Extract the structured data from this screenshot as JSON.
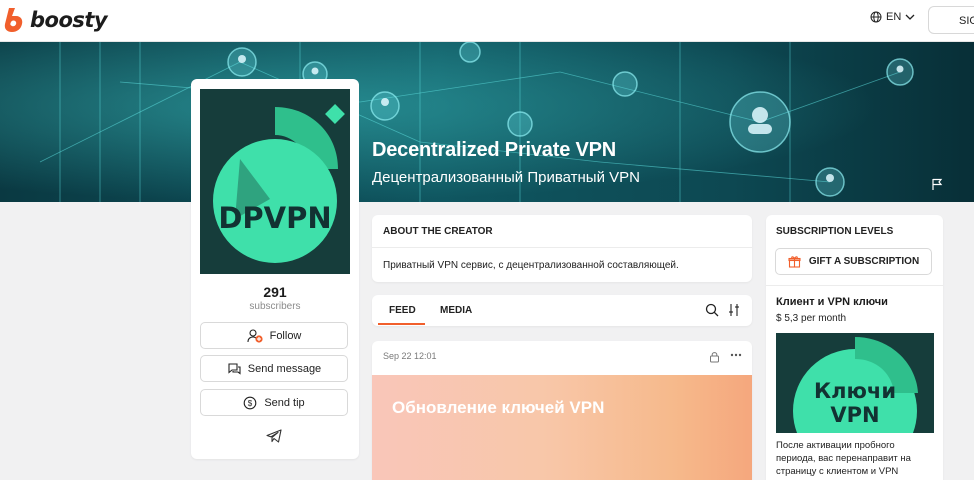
{
  "header": {
    "brand": "boosty",
    "language": "EN",
    "signin_label": "SIG"
  },
  "banner": {
    "title": "Decentralized Private VPN",
    "subtitle": "Децентрализованный Приватный VPN"
  },
  "profile": {
    "avatar_text": "DPVPN",
    "subscriber_count": "291",
    "subscriber_label": "subscribers",
    "follow_label": "Follow",
    "message_label": "Send message",
    "tip_label": "Send tip"
  },
  "about": {
    "heading": "ABOUT THE CREATOR",
    "text": "Приватный VPN сервис, с децентрализованной составляющей."
  },
  "tabs": {
    "feed": "FEED",
    "media": "MEDIA"
  },
  "post": {
    "date": "Sep 22 12:01",
    "cover_title": "Обновление ключей VPN"
  },
  "subscriptions": {
    "heading": "SUBSCRIPTION LEVELS",
    "gift_label": "GIFT A SUBSCRIPTION",
    "tier": {
      "name": "Клиент и VPN ключи",
      "price": "$ 5,3 per month",
      "image_line1": "Ключи",
      "image_line2": "VPN",
      "description": "После активации пробного периода, вас перенаправит на страницу с клиентом и VPN"
    }
  },
  "colors": {
    "accent": "#f15f2c",
    "brand_teal": "#3de0a8",
    "dark_teal": "#143b3a"
  }
}
